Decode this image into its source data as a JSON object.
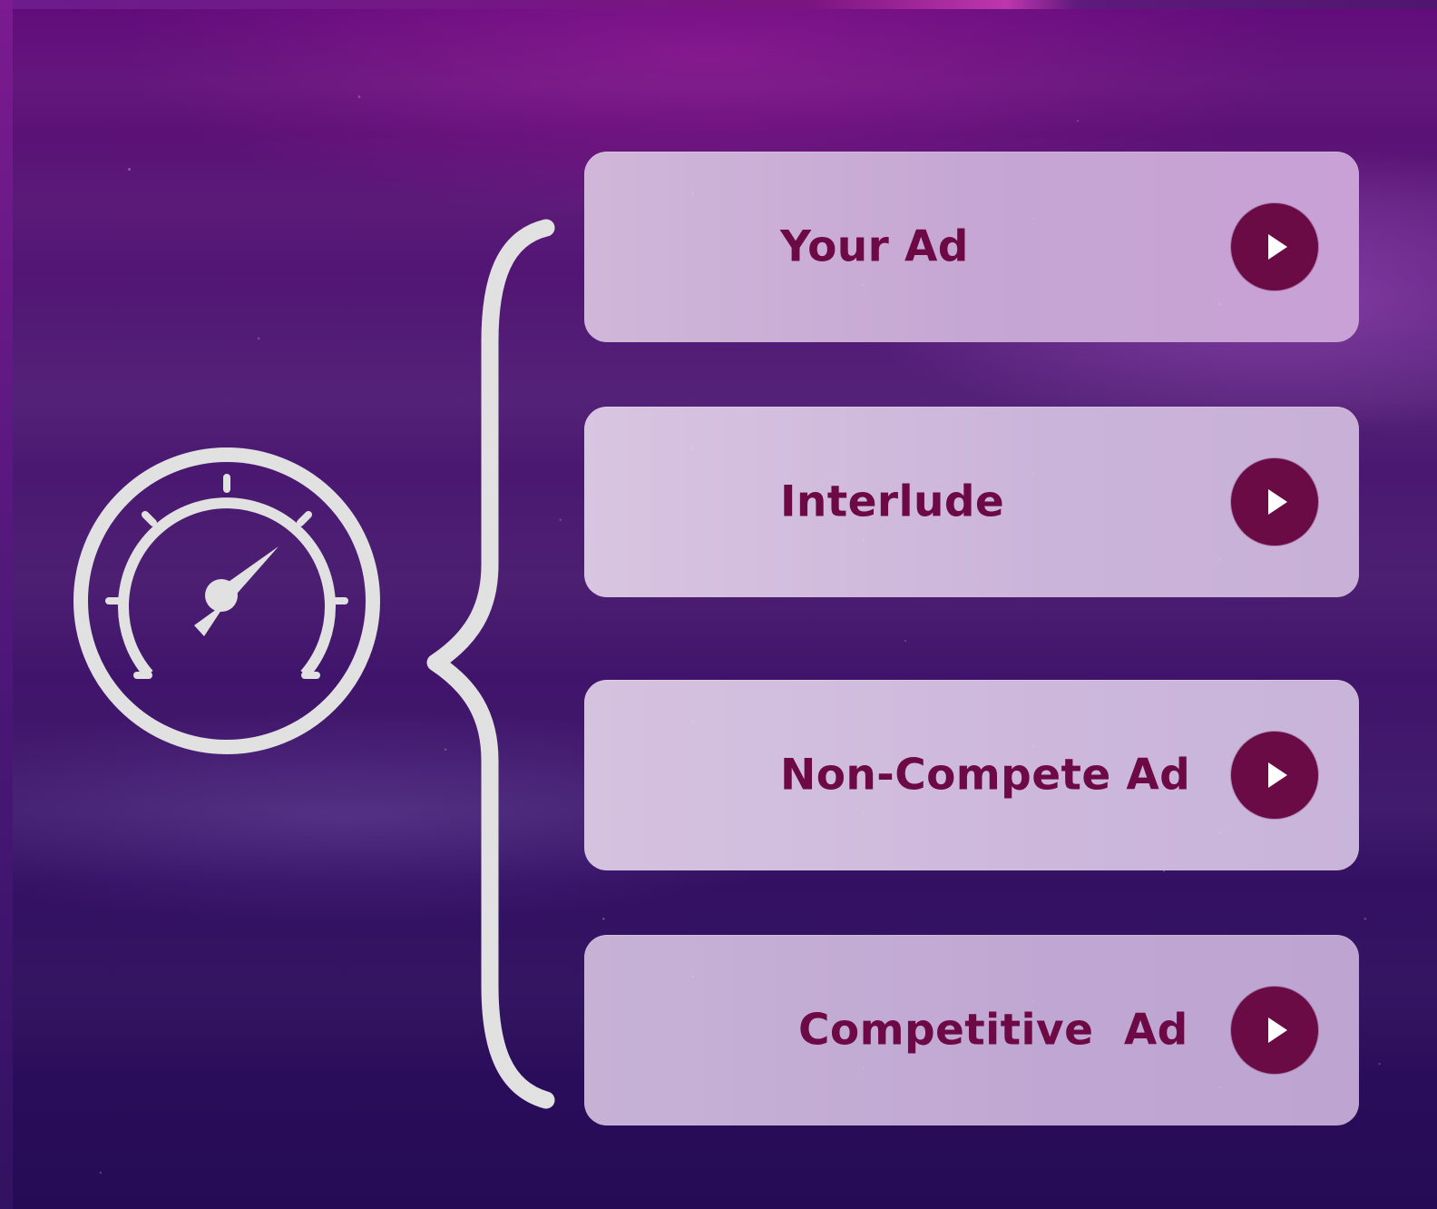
{
  "items": [
    {
      "label": "Your Ad",
      "icon": "play-icon"
    },
    {
      "label": "Interlude",
      "icon": "play-icon"
    },
    {
      "label": "Non-Compete Ad",
      "icon": "play-icon"
    },
    {
      "label": "Competitive  Ad",
      "icon": "play-icon"
    }
  ],
  "icons": {
    "gauge": "speedometer-icon",
    "brace": "curly-brace-icon",
    "play": "play-icon"
  },
  "colors": {
    "background_top": "#620b7b",
    "background_bottom": "#250b55",
    "card_fill": "#cdb4d9",
    "text_color": "#6d0a46",
    "play_button": "#6b0b45",
    "icon_fill": "#e1e1e1"
  }
}
